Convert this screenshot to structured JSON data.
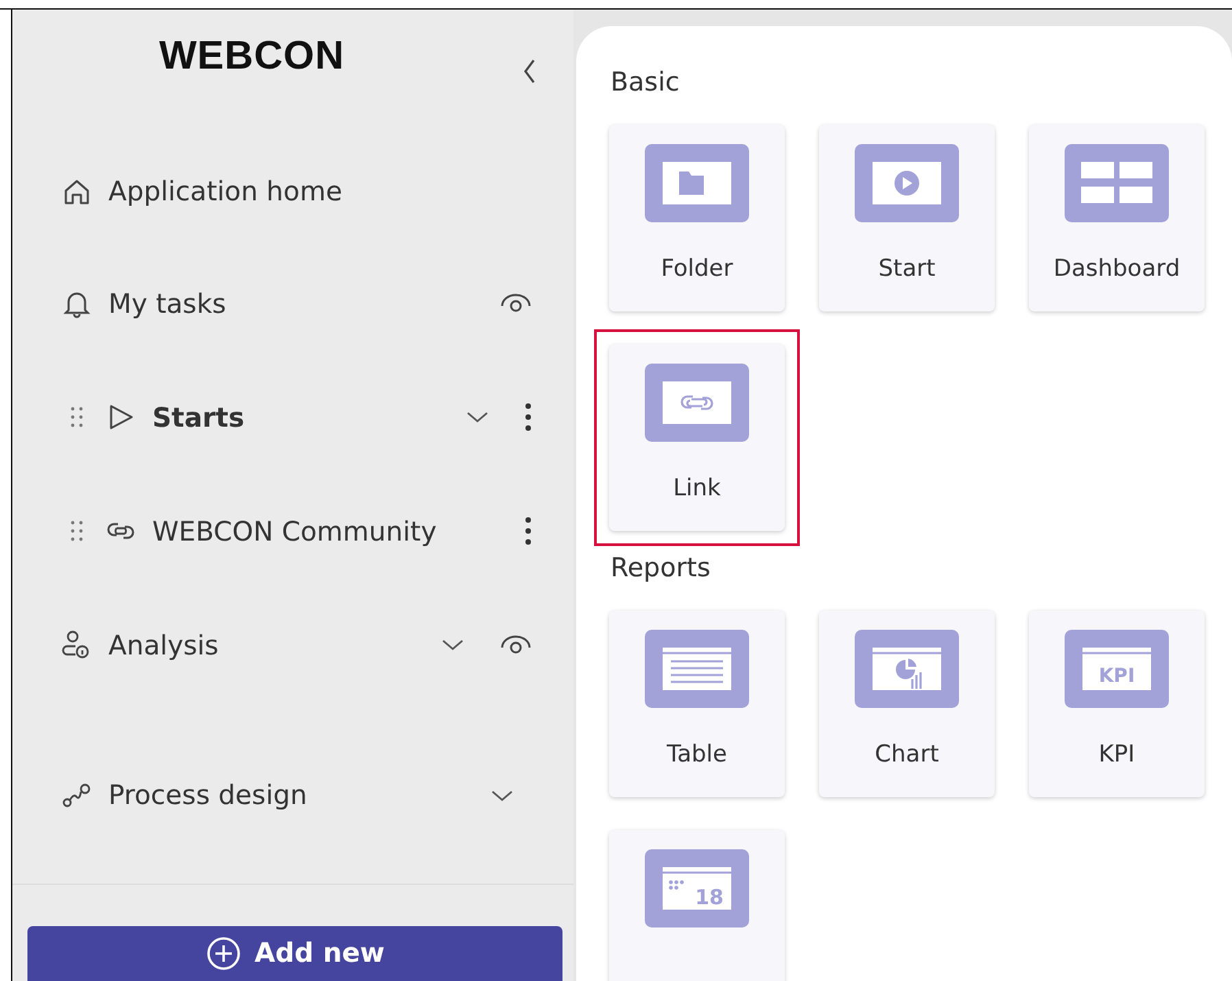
{
  "sidebar": {
    "logo": "WEBCON",
    "items": [
      {
        "label": "Application home",
        "kind": "home",
        "bold": false,
        "draggable": false,
        "expandable": false,
        "watched": false,
        "has_menu": false
      },
      {
        "label": "My tasks",
        "kind": "bell",
        "bold": false,
        "draggable": false,
        "expandable": false,
        "watched": true,
        "has_menu": false
      },
      {
        "label": "Starts",
        "kind": "play",
        "bold": true,
        "draggable": true,
        "expandable": true,
        "watched": false,
        "has_menu": true
      },
      {
        "label": "WEBCON Community",
        "kind": "link",
        "bold": false,
        "draggable": true,
        "expandable": false,
        "watched": false,
        "has_menu": true
      },
      {
        "label": "Analysis",
        "kind": "person-info",
        "bold": false,
        "draggable": false,
        "expandable": true,
        "watched": true,
        "has_menu": false
      },
      {
        "label": "Process design",
        "kind": "flow",
        "bold": false,
        "draggable": false,
        "expandable": true,
        "watched": false,
        "has_menu": false
      }
    ],
    "add_button": "Add new"
  },
  "sections": [
    {
      "title": "Basic",
      "tiles": [
        {
          "label": "Folder",
          "kind": "folder",
          "highlighted": false
        },
        {
          "label": "Start",
          "kind": "start",
          "highlighted": false
        },
        {
          "label": "Dashboard",
          "kind": "dashboard",
          "highlighted": false
        },
        {
          "label": "Link",
          "kind": "link",
          "highlighted": true
        }
      ]
    },
    {
      "title": "Reports",
      "tiles": [
        {
          "label": "Table",
          "kind": "table",
          "highlighted": false
        },
        {
          "label": "Chart",
          "kind": "chart",
          "highlighted": false
        },
        {
          "label": "KPI",
          "kind": "kpi",
          "icon_text": "KPI",
          "highlighted": false
        },
        {
          "kind": "calendar",
          "icon_text": "18",
          "highlighted": false
        }
      ]
    }
  ]
}
